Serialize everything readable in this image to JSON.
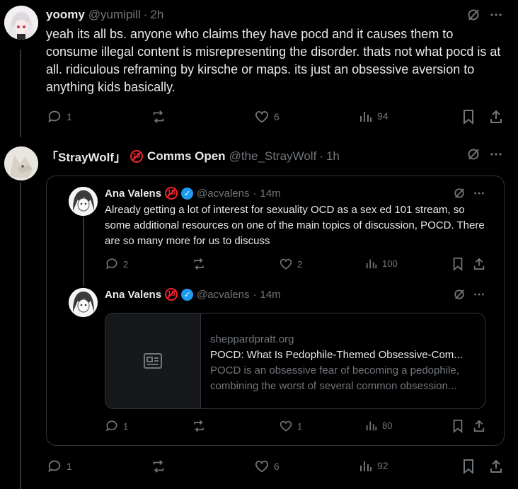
{
  "post1": {
    "display_name": "yoomy",
    "handle": "@yumipill",
    "time": "2h",
    "text": "yeah its all bs. anyone who claims they have pocd and it causes them to consume illegal content is misrepresenting the disorder. thats not what pocd is at all. ridiculous reframing by kirsche or maps. its just an obsessive aversion to anything kids basically.",
    "replies": "1",
    "reposts": "",
    "likes": "6",
    "views": "94"
  },
  "post2": {
    "display_name": "「StrayWolf」🔞 Comms Open",
    "display_name_a": "「StrayWolf」",
    "display_name_b": "Comms Open",
    "handle": "@the_StrayWolf",
    "time": "1h",
    "replies": "1",
    "reposts": "",
    "likes": "6",
    "views": "92"
  },
  "quote1": {
    "display_name": "Ana Valens",
    "handle": "@acvalens",
    "time": "14m",
    "text": "Already getting a lot of interest for sexuality OCD as a sex ed 101 stream, so some additional resources on one of the main topics of discussion, POCD. There are so many more for us to discuss",
    "replies": "2",
    "reposts": "",
    "likes": "2",
    "views": "100"
  },
  "quote2": {
    "display_name": "Ana Valens",
    "handle": "@acvalens",
    "time": "14m",
    "replies": "1",
    "reposts": "",
    "likes": "1",
    "views": "80",
    "card": {
      "domain": "sheppardpratt.org",
      "title": "POCD: What Is Pedophile-Themed Obsessive-Com...",
      "description": "POCD is an obsessive fear of becoming a pedophile, combining the worst of several common obsession..."
    }
  },
  "badge_text": "18",
  "colors": {
    "accent": "#1d9bf0",
    "muted": "#71767b",
    "badge": "#f4212e",
    "border": "#2f3336"
  }
}
